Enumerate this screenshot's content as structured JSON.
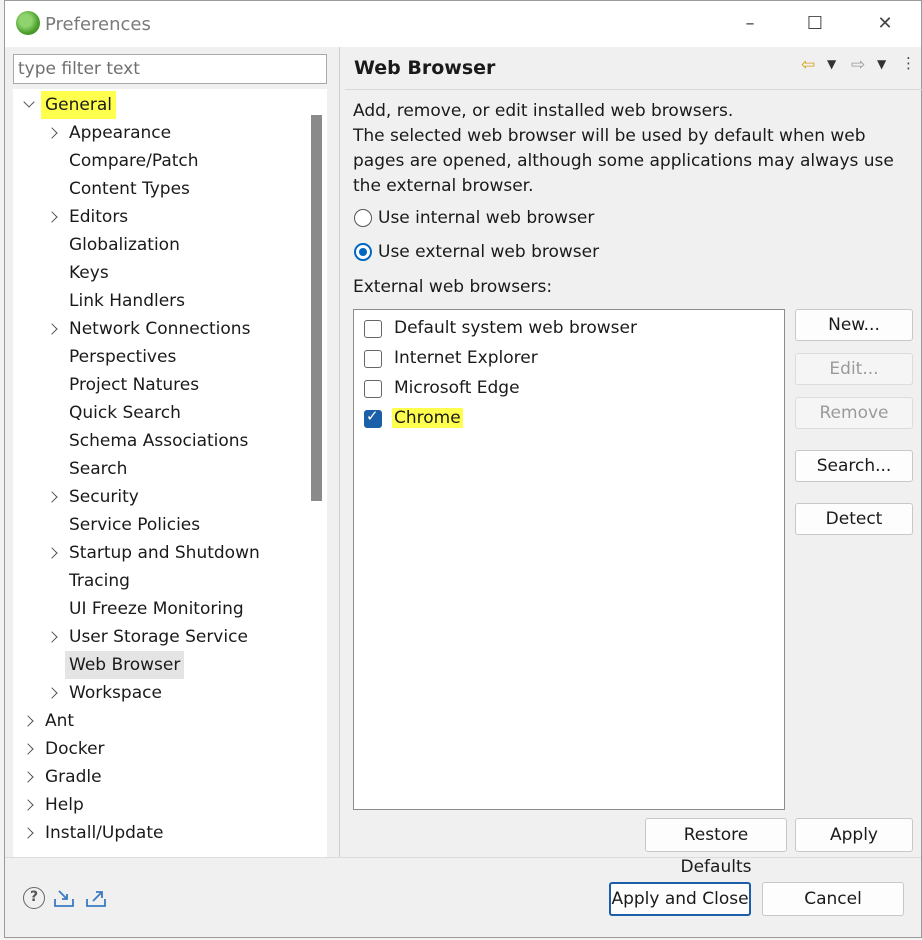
{
  "window": {
    "title": "Preferences"
  },
  "filter": {
    "placeholder": "type filter text"
  },
  "tree": [
    {
      "label": "General",
      "level": 0,
      "expanded": true,
      "highlighted": true
    },
    {
      "label": "Appearance",
      "level": 1,
      "has_children": true
    },
    {
      "label": "Compare/Patch",
      "level": 1
    },
    {
      "label": "Content Types",
      "level": 1
    },
    {
      "label": "Editors",
      "level": 1,
      "has_children": true
    },
    {
      "label": "Globalization",
      "level": 1
    },
    {
      "label": "Keys",
      "level": 1
    },
    {
      "label": "Link Handlers",
      "level": 1
    },
    {
      "label": "Network Connections",
      "level": 1,
      "has_children": true
    },
    {
      "label": "Perspectives",
      "level": 1
    },
    {
      "label": "Project Natures",
      "level": 1
    },
    {
      "label": "Quick Search",
      "level": 1
    },
    {
      "label": "Schema Associations",
      "level": 1
    },
    {
      "label": "Search",
      "level": 1
    },
    {
      "label": "Security",
      "level": 1,
      "has_children": true
    },
    {
      "label": "Service Policies",
      "level": 1
    },
    {
      "label": "Startup and Shutdown",
      "level": 1,
      "has_children": true
    },
    {
      "label": "Tracing",
      "level": 1
    },
    {
      "label": "UI Freeze Monitoring",
      "level": 1
    },
    {
      "label": "User Storage Service",
      "level": 1,
      "has_children": true
    },
    {
      "label": "Web Browser",
      "level": 1,
      "selected": true,
      "highlighted": true
    },
    {
      "label": "Workspace",
      "level": 1,
      "has_children": true
    },
    {
      "label": "Ant",
      "level": 0,
      "has_children": true
    },
    {
      "label": "Docker",
      "level": 0,
      "has_children": true
    },
    {
      "label": "Gradle",
      "level": 0,
      "has_children": true
    },
    {
      "label": "Help",
      "level": 0,
      "has_children": true
    },
    {
      "label": "Install/Update",
      "level": 0,
      "has_children": true
    }
  ],
  "page": {
    "title": "Web Browser",
    "desc_line1": "Add, remove, or edit installed web browsers.",
    "desc_line2": "The selected web browser will be used by default when web pages are opened, although some applications may always use the external browser.",
    "radio_internal": "Use internal web browser",
    "radio_external": "Use external web browser",
    "selected_radio": "external",
    "list_label": "External web browsers:",
    "browsers": [
      {
        "label": "Default system web browser",
        "checked": false
      },
      {
        "label": "Internet Explorer",
        "checked": false
      },
      {
        "label": "Microsoft Edge",
        "checked": false
      },
      {
        "label": "Chrome",
        "checked": true,
        "highlighted": true
      }
    ],
    "buttons": {
      "new": "New...",
      "edit": "Edit...",
      "remove": "Remove",
      "search": "Search...",
      "detect": "Detect",
      "restore": "Restore Defaults",
      "apply": "Apply"
    }
  },
  "footer": {
    "apply_close": "Apply and Close",
    "cancel": "Cancel"
  },
  "colors": {
    "highlight": "#ffff4d",
    "accent": "#0067c0"
  }
}
